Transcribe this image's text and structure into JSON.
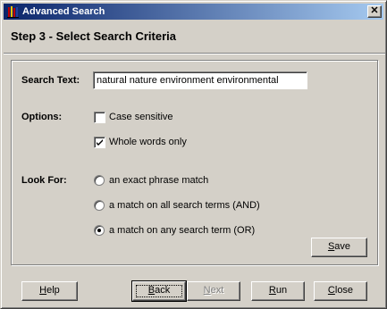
{
  "window": {
    "title": "Advanced Search",
    "close_glyph": "✕",
    "app_icon": "app-books-icon"
  },
  "step_title": "Step 3 - Select Search Criteria",
  "search": {
    "label": "Search Text:",
    "value": "natural nature environment environmental"
  },
  "options": {
    "label": "Options:",
    "items": [
      {
        "label": "Case sensitive",
        "checked": false
      },
      {
        "label": "Whole words only",
        "checked": true
      }
    ]
  },
  "look_for": {
    "label": "Look For:",
    "items": [
      {
        "label": "an exact phrase match",
        "selected": false
      },
      {
        "label": "a match on all search terms (AND)",
        "selected": false
      },
      {
        "label": "a match on any search term (OR)",
        "selected": true
      }
    ]
  },
  "buttons": {
    "save": {
      "pre": "",
      "accel": "S",
      "post": "ave"
    },
    "help": {
      "pre": "",
      "accel": "H",
      "post": "elp"
    },
    "back": {
      "pre": "",
      "accel": "B",
      "post": "ack"
    },
    "next": {
      "pre": "",
      "accel": "N",
      "post": "ext",
      "disabled": true
    },
    "run": {
      "pre": "",
      "accel": "R",
      "post": "un"
    },
    "close": {
      "pre": "",
      "accel": "C",
      "post": "lose"
    }
  }
}
